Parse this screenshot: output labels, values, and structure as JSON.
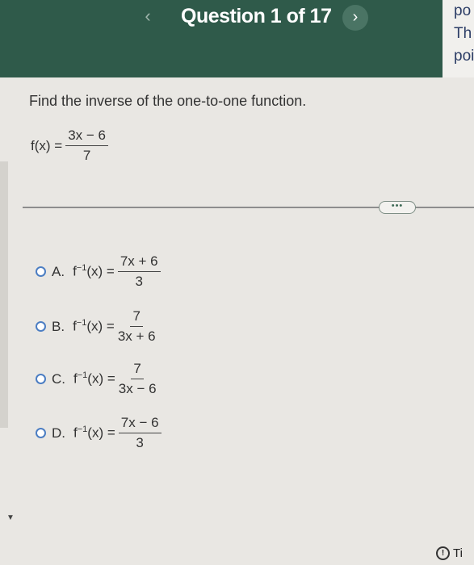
{
  "header": {
    "title": "Question 1 of 17",
    "prev_glyph": "‹",
    "next_glyph": "›",
    "side_lines": [
      "po",
      "Th",
      "poi"
    ]
  },
  "question": {
    "prompt": "Find the inverse of the one-to-one function.",
    "function": {
      "lhs": "f(x) =",
      "numerator": "3x − 6",
      "denominator": "7"
    }
  },
  "more_label": "•••",
  "choices": [
    {
      "letter": "A.",
      "lhs_base": "f",
      "lhs_exp": "−1",
      "lhs_arg": "(x) =",
      "numerator": "7x + 6",
      "denominator": "3"
    },
    {
      "letter": "B.",
      "lhs_base": "f",
      "lhs_exp": "−1",
      "lhs_arg": "(x) =",
      "numerator": "7",
      "denominator": "3x + 6"
    },
    {
      "letter": "C.",
      "lhs_base": "f",
      "lhs_exp": "−1",
      "lhs_arg": "(x) =",
      "numerator": "7",
      "denominator": "3x − 6"
    },
    {
      "letter": "D.",
      "lhs_base": "f",
      "lhs_exp": "−1",
      "lhs_arg": "(x) =",
      "numerator": "7x − 6",
      "denominator": "3"
    }
  ],
  "footer": {
    "timer_icon_glyph": "!",
    "timer_text": "Ti"
  },
  "colors": {
    "header": "#2f5a4a",
    "radio": "#4c7ec3",
    "background": "#e9e7e3"
  }
}
